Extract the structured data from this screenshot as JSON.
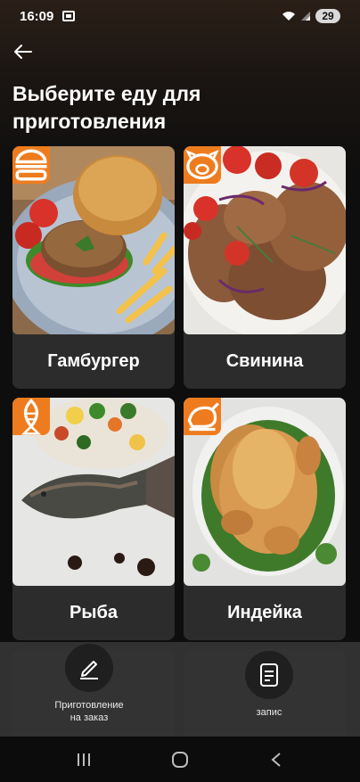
{
  "status_bar": {
    "time": "16:09",
    "battery": "29"
  },
  "header": {
    "back_icon": "arrow-left-icon",
    "title": "Выберите еду для приготовления"
  },
  "colors": {
    "accent": "#ee7c1f",
    "card_bg": "#2c2c2c",
    "background": "#0e0e0e"
  },
  "foods": [
    {
      "label": "Гамбургер",
      "icon": "burger-icon"
    },
    {
      "label": "Свинина",
      "icon": "pig-icon"
    },
    {
      "label": "Рыба",
      "icon": "fish-icon"
    },
    {
      "label": "Индейка",
      "icon": "turkey-icon"
    }
  ],
  "actions": [
    {
      "label_line1": "Приготовление",
      "label_line2": "на заказ",
      "icon": "pencil-icon"
    },
    {
      "label": "запис",
      "icon": "document-icon"
    }
  ],
  "nav": {
    "recent": "recent-apps-icon",
    "home": "home-icon",
    "back": "back-icon"
  }
}
